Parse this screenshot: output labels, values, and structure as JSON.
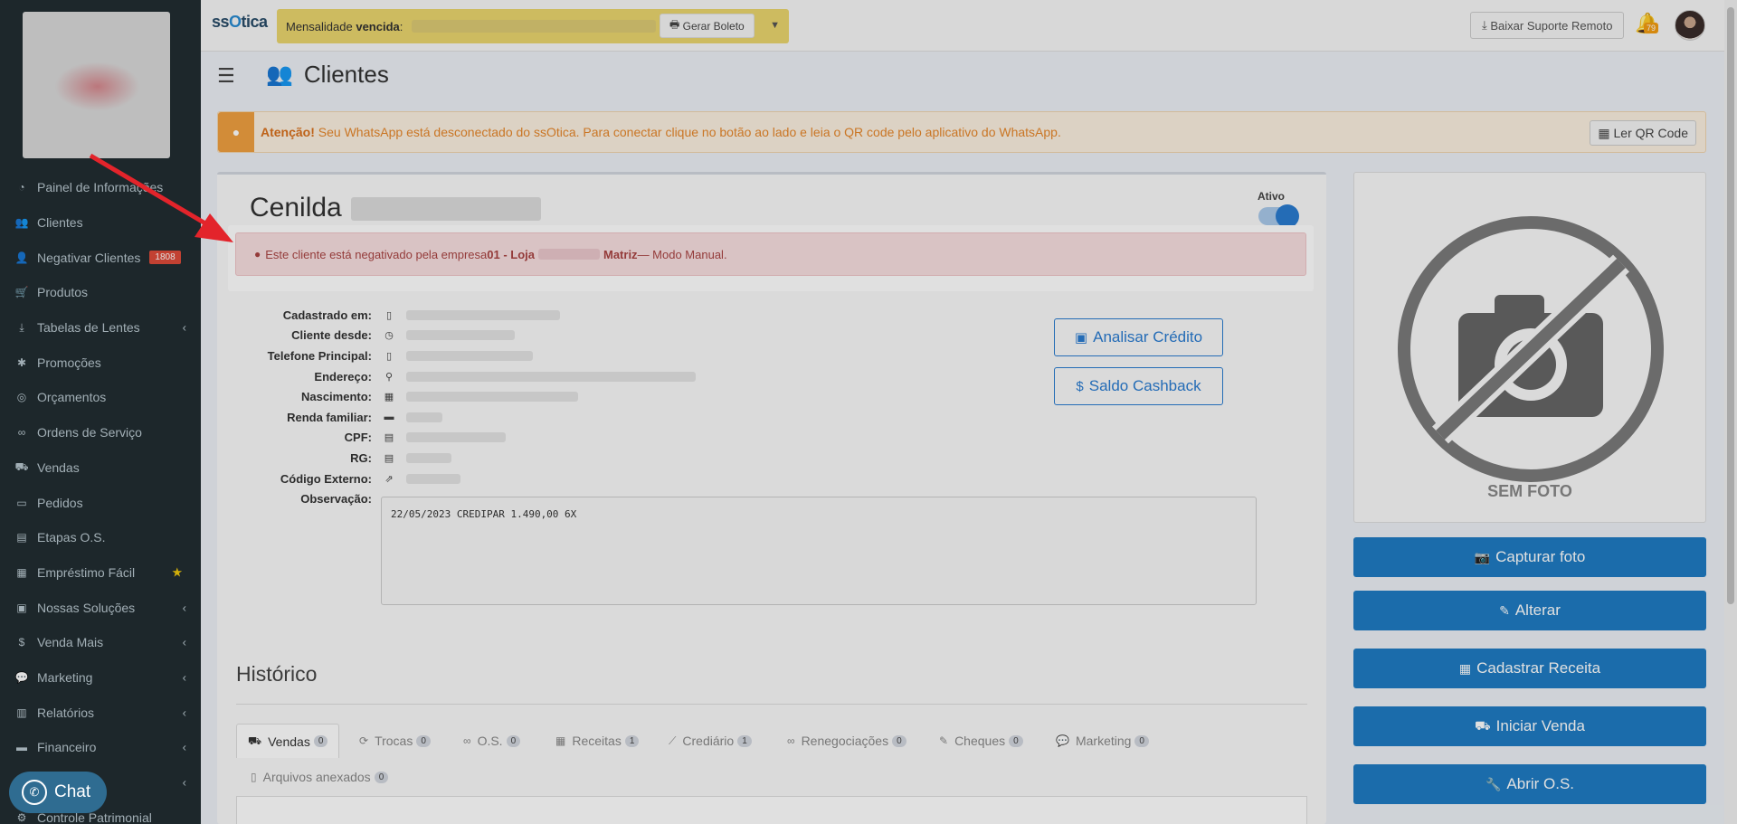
{
  "brand": {
    "prefix": "ss",
    "o": "O",
    "suffix": "tica"
  },
  "billing": {
    "label": "Mensalidade",
    "strong": "vencida",
    "colon": ":",
    "boleto_label": "Gerar Boleto"
  },
  "topbar": {
    "remote_label": "Baixar Suporte Remoto",
    "notifications_count": "79"
  },
  "sidebar": {
    "items": [
      {
        "label": "Painel de Informações",
        "icon": "dashboard-icon"
      },
      {
        "label": "Clientes",
        "icon": "users-icon"
      },
      {
        "label": "Negativar Clientes",
        "icon": "user-minus-icon",
        "badge": "1808"
      },
      {
        "label": "Produtos",
        "icon": "cart-icon"
      },
      {
        "label": "Tabelas de Lentes",
        "icon": "download-icon",
        "submenu": true
      },
      {
        "label": "Promoções",
        "icon": "asterisk-icon"
      },
      {
        "label": "Orçamentos",
        "icon": "money-icon"
      },
      {
        "label": "Ordens de Serviço",
        "icon": "glasses-icon"
      },
      {
        "label": "Vendas",
        "icon": "basket-icon"
      },
      {
        "label": "Pedidos",
        "icon": "inbox-icon"
      },
      {
        "label": "Etapas O.S.",
        "icon": "stages-icon"
      },
      {
        "label": "Empréstimo Fácil",
        "icon": "calculator-icon",
        "star": true
      },
      {
        "label": "Nossas Soluções",
        "icon": "briefcase-icon",
        "submenu": true
      },
      {
        "label": "Venda Mais",
        "icon": "dollar-icon",
        "submenu": true
      },
      {
        "label": "Marketing",
        "icon": "comments-icon",
        "submenu": true
      },
      {
        "label": "Relatórios",
        "icon": "report-icon",
        "submenu": true
      },
      {
        "label": "Financeiro",
        "icon": "cash-icon",
        "submenu": true
      },
      {
        "label": "",
        "icon": "",
        "submenu": true
      },
      {
        "label": "Controle Patrimonial",
        "icon": "asset-icon"
      }
    ],
    "chat_label": "Chat"
  },
  "header": {
    "title": "Clientes"
  },
  "wa_alert": {
    "strong": "Atenção!",
    "text": " Seu WhatsApp está desconectado do ssOtica. Para conectar clique no botão ao lado e leia o QR code pelo aplicativo do WhatsApp.",
    "button": "Ler QR Code"
  },
  "client": {
    "name": "Cenilda",
    "status_label": "Ativo",
    "negative_alert": {
      "prefix": "Este cliente está negativado pela empresa ",
      "company_start": "01 - Loja",
      "company_end": "Matriz",
      "suffix": " — Modo Manual."
    },
    "fields": [
      {
        "label": "Cadastrado em:",
        "icon": "building-icon"
      },
      {
        "label": "Cliente desde:",
        "icon": "clock-icon"
      },
      {
        "label": "Telefone Principal:",
        "icon": "mobile-icon"
      },
      {
        "label": "Endereço:",
        "icon": "map-marker-icon"
      },
      {
        "label": "Nascimento:",
        "icon": "calendar-icon"
      },
      {
        "label": "Renda familiar:",
        "icon": "money-bill-icon"
      },
      {
        "label": "CPF:",
        "icon": "id-card-icon"
      },
      {
        "label": "RG:",
        "icon": "id-card-icon"
      },
      {
        "label": "Código Externo:",
        "icon": "external-link-icon"
      },
      {
        "label": "Observação:",
        "icon": ""
      }
    ],
    "observation": "22/05/2023 CREDIPAR 1.490,00 6X",
    "analyze_credit": "Analisar Crédito",
    "cashback": "Saldo Cashback"
  },
  "photo": {
    "placeholder": "SEM FOTO"
  },
  "actions": {
    "capture": "Capturar foto",
    "edit": "Alterar",
    "recipe": "Cadastrar Receita",
    "sale": "Iniciar Venda",
    "os": "Abrir O.S."
  },
  "history": {
    "title": "Histórico",
    "tabs": [
      {
        "label": "Vendas",
        "count": "0",
        "active": true
      },
      {
        "label": "Trocas",
        "count": "0"
      },
      {
        "label": "O.S.",
        "count": "0"
      },
      {
        "label": "Receitas",
        "count": "1"
      },
      {
        "label": "Crediário",
        "count": "1"
      },
      {
        "label": "Renegociações",
        "count": "0"
      },
      {
        "label": "Cheques",
        "count": "0"
      },
      {
        "label": "Marketing",
        "count": "0"
      },
      {
        "label": "Arquivos anexados",
        "count": "0"
      }
    ]
  },
  "colors": {
    "sidebar": "#222d32",
    "primary": "#1f7cc3",
    "danger": "#a94442",
    "warning": "#e6872b"
  }
}
